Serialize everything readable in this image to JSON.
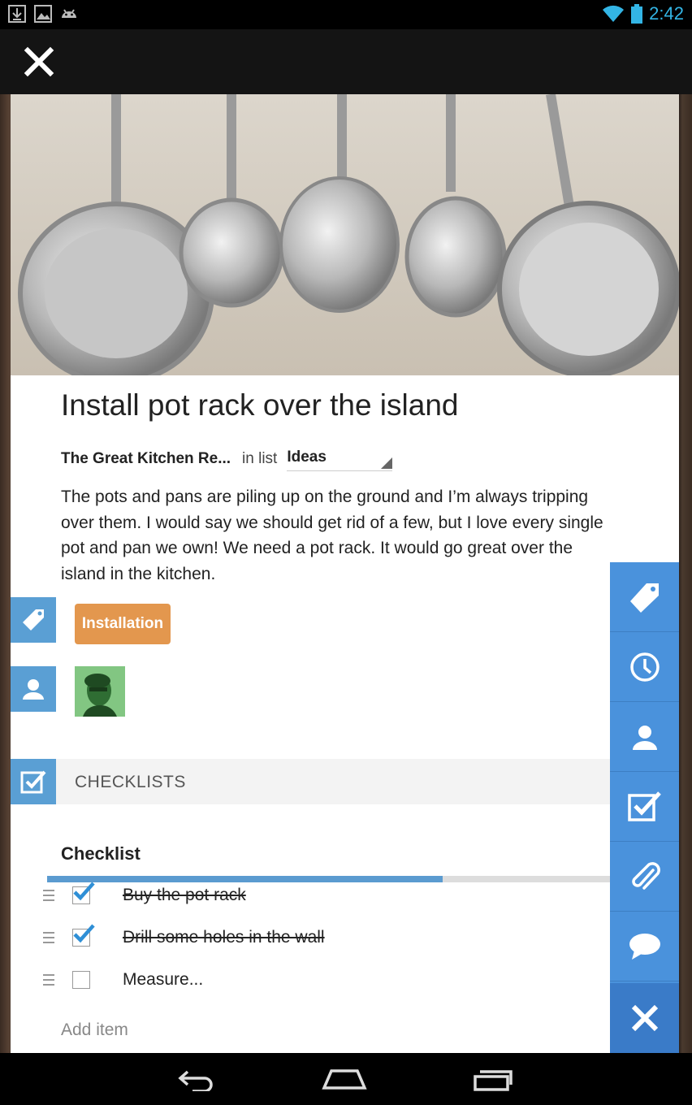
{
  "status_bar": {
    "time": "2:42",
    "left_icons": [
      "download-icon",
      "image-icon",
      "android-icon"
    ],
    "right_icons": [
      "wifi-icon",
      "battery-icon"
    ],
    "clock_color": "#33b5e5"
  },
  "card": {
    "title": "Install pot rack over the island",
    "board_name": "The Great Kitchen Re...",
    "in_list_label": "in list",
    "list_name": "Ideas",
    "description": "The pots and pans are piling up on the ground and I’m always tripping over them. I would say we should get rid of a few, but I love every single pot and pan we own! We need a pot rack. It would go great over the island in the kitchen.",
    "label": {
      "text": "Installation",
      "color": "#e3974e"
    },
    "checklists_header": "CHECKLISTS",
    "checklist": {
      "title": "Checklist",
      "progress": 0.7,
      "items": [
        {
          "text": "Buy the pot rack",
          "checked": true
        },
        {
          "text": "Drill some holes in the wall",
          "checked": true
        },
        {
          "text": "Measure...",
          "checked": false
        }
      ],
      "add_item_placeholder": "Add item"
    }
  },
  "action_column": {
    "buttons": [
      "tag-icon",
      "clock-icon",
      "person-icon",
      "checklist-icon",
      "paperclip-icon",
      "comment-icon",
      "close-icon"
    ]
  },
  "colors": {
    "accent_blue": "#4a92dc",
    "side_button_blue": "#5a9fd4",
    "progress_blue": "#5b9bd0"
  }
}
